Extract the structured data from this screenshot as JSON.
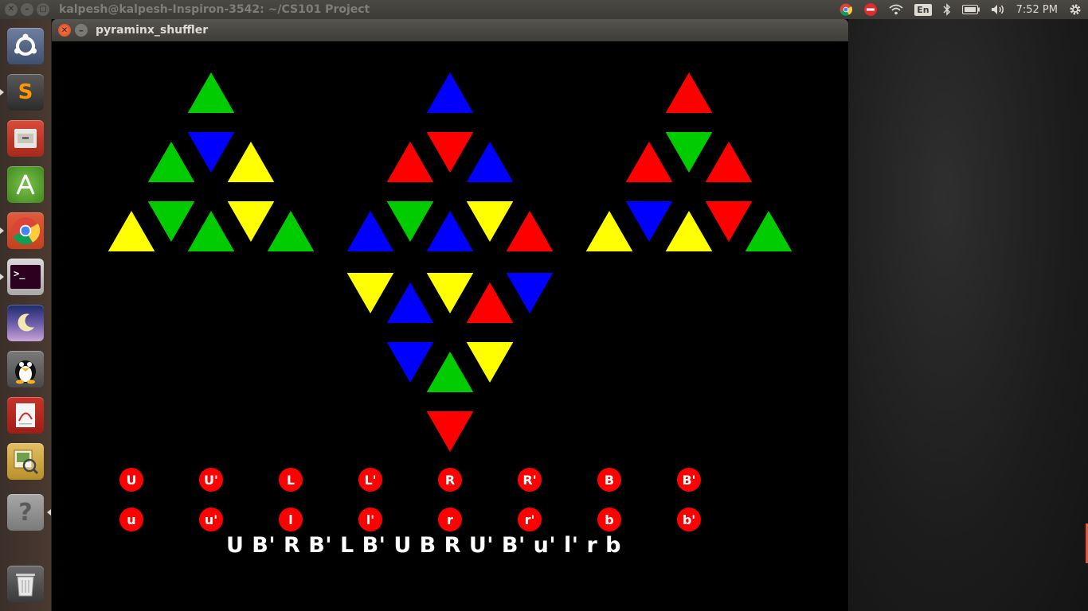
{
  "top_panel": {
    "title": "kalpesh@kalpesh-Inspiron-3542: ~/CS101 Project",
    "keyboard": "En",
    "clock": "7:52 PM"
  },
  "launcher": {
    "items": [
      {
        "name": "ubuntu-dash-icon"
      },
      {
        "name": "sublime-text-icon",
        "glyph": "S"
      },
      {
        "name": "files-icon"
      },
      {
        "name": "android-studio-icon"
      },
      {
        "name": "chrome-icon"
      },
      {
        "name": "terminal-icon",
        "glyph": ">_"
      },
      {
        "name": "stellarium-icon"
      },
      {
        "name": "supertux-icon"
      },
      {
        "name": "document-viewer-icon"
      },
      {
        "name": "image-viewer-icon"
      },
      {
        "name": "help-icon",
        "glyph": "?"
      },
      {
        "name": "trash-icon"
      }
    ]
  },
  "window": {
    "title": "pyraminx_shuffler"
  },
  "colors": {
    "G": "#00cc00",
    "B": "#0000ff",
    "Y": "#ffff00",
    "R": "#ff0000"
  },
  "faces": {
    "left": [
      "G",
      "G",
      "B",
      "Y",
      "Y",
      "G",
      "G",
      "Y",
      "G"
    ],
    "center_top": [
      "B",
      "R",
      "R",
      "B",
      "B",
      "G",
      "B",
      "Y",
      "R"
    ],
    "right": [
      "R",
      "R",
      "G",
      "R",
      "Y",
      "B",
      "Y",
      "R",
      "G"
    ],
    "center_bottom": [
      "Y",
      "B",
      "Y",
      "R",
      "B",
      "B",
      "G",
      "Y",
      "R"
    ]
  },
  "moves_row1": [
    "U",
    "U'",
    "L",
    "L'",
    "R",
    "R'",
    "B",
    "B'"
  ],
  "moves_row2": [
    "u",
    "u'",
    "l",
    "l'",
    "r",
    "r'",
    "b",
    "b'"
  ],
  "sequence": "U B' R B' L B' U B R U' B' u' l' r b"
}
